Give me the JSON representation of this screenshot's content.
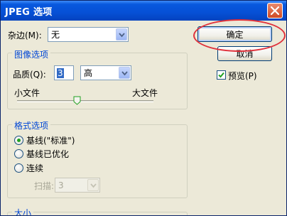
{
  "window": {
    "title": "JPEG 选项"
  },
  "matte": {
    "label": "杂边(M):",
    "value": "无"
  },
  "image_options": {
    "legend": "图像选项",
    "quality_label": "品质(Q):",
    "quality_value": "3",
    "quality_preset": "高",
    "small_file": "小文件",
    "large_file": "大文件",
    "slider_level": 0.44
  },
  "format_options": {
    "legend": "格式选项",
    "options": [
      "基线(\"标准\")",
      "基线已优化",
      "连续"
    ],
    "selected_index": 0,
    "scans_label": "扫描:",
    "scans_value": "3"
  },
  "size": {
    "legend": "大小"
  },
  "buttons": {
    "ok": "确定",
    "cancel": "取消"
  },
  "preview": {
    "label": "预览(P)",
    "checked": true
  },
  "colors": {
    "title_blue": "#0858de",
    "legend_blue": "#0046d5",
    "annotation_red": "#e0303a"
  }
}
